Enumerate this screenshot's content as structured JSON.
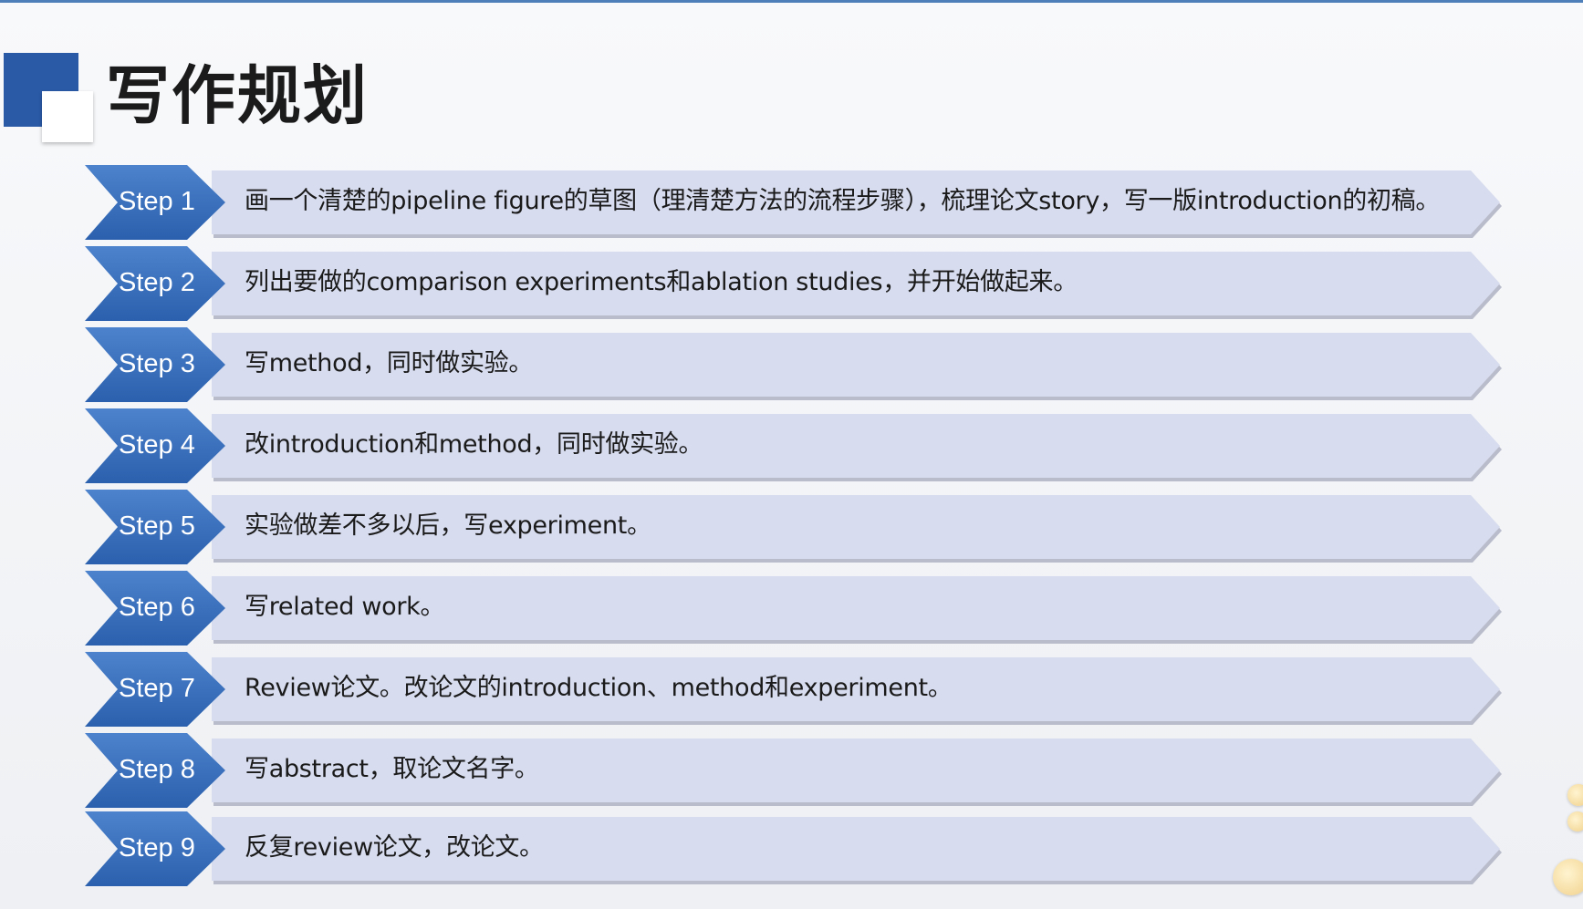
{
  "slide": {
    "title": "写作规划",
    "steps": [
      {
        "label": "Step 1",
        "text": "画一个清楚的pipeline figure的草图（理清楚方法的流程步骤），梳理论文story，写一版introduction的初稿。"
      },
      {
        "label": "Step 2",
        "text": "列出要做的comparison experiments和ablation studies，并开始做起来。"
      },
      {
        "label": "Step 3",
        "text": "写method，同时做实验。"
      },
      {
        "label": "Step 4",
        "text": "改introduction和method，同时做实验。"
      },
      {
        "label": "Step 5",
        "text": "实验做差不多以后，写experiment。"
      },
      {
        "label": "Step 6",
        "text": "写related work。"
      },
      {
        "label": "Step 7",
        "text": "Review论文。改论文的introduction、method和experiment。"
      },
      {
        "label": "Step 8",
        "text": "写abstract，取论文名字。"
      },
      {
        "label": "Step 9",
        "text": "反复review论文，改论文。"
      }
    ]
  },
  "colors": {
    "accent_blue": "#2a5aa6",
    "chevron_blue": "#3e72bf",
    "bar_fill": "#d7dcee",
    "title_text": "#1b1b1b"
  }
}
